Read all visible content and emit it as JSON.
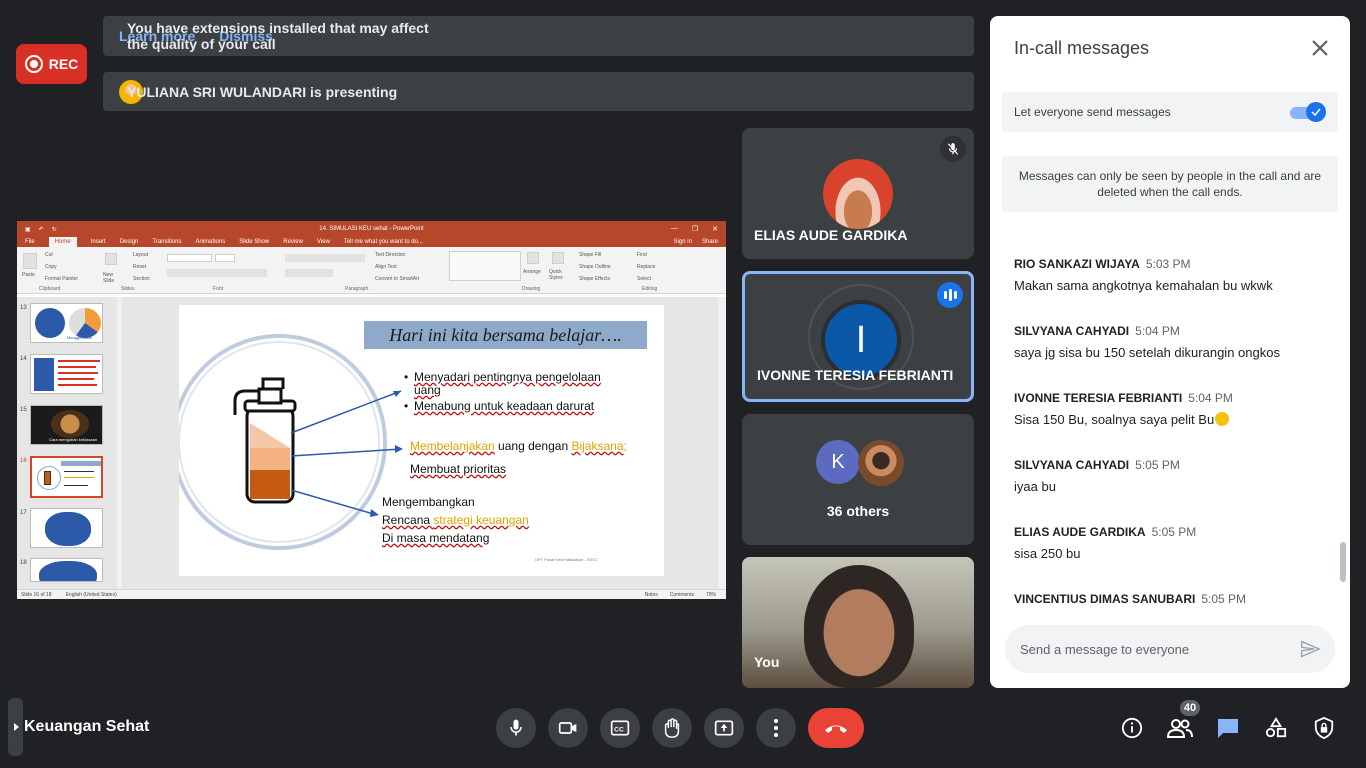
{
  "rec": {
    "label": "REC"
  },
  "banner_warning": {
    "message": "You have extensions installed that may affect the quality of your call",
    "learn_more": "Learn more",
    "dismiss": "Dismiss"
  },
  "banner_presenting": {
    "message": "YULIANA SRI WULANDARI is presenting"
  },
  "powerpoint": {
    "window_title": "14. SIMULASI KEU sehat - PowerPoint",
    "tabs": [
      "File",
      "Home",
      "Insert",
      "Design",
      "Transitions",
      "Animations",
      "Slide Show",
      "Review",
      "View",
      "Tell me what you want to do..."
    ],
    "active_tab": "Home",
    "sign_in": "Sign in",
    "share": "Share",
    "ribbon_groups": [
      "Clipboard",
      "Slides",
      "Font",
      "Paragraph",
      "Drawing",
      "Editing"
    ],
    "ribbon_items": {
      "paste": "Paste",
      "cut": "Cut",
      "copy": "Copy",
      "format_painter": "Format Painter",
      "new_slide": "New Slide",
      "layout": "Layout",
      "reset": "Reset",
      "section": "Section",
      "text_direction": "Text Direction",
      "align_text": "Align Text",
      "convert_smartart": "Convert to SmartArt",
      "arrange": "Arrange",
      "quick_styles": "Quick Styles",
      "shape_fill": "Shape Fill",
      "shape_outline": "Shape Outline",
      "shape_effects": "Shape Effects",
      "find": "Find",
      "replace": "Replace",
      "select": "Select"
    },
    "thumbnails": [
      {
        "num": "13",
        "caption": "Menggelolaan"
      },
      {
        "num": "14",
        "caption": ""
      },
      {
        "num": "15",
        "caption": "Cara mengubah kebiasaan"
      },
      {
        "num": "16",
        "caption": ""
      },
      {
        "num": "17",
        "caption": ""
      },
      {
        "num": "18",
        "caption": ""
      }
    ],
    "slide": {
      "title": "Hari ini kita bersama belajar….",
      "bullet1": "Menyadari pentingnya pengelolaan uang",
      "bullet2": "Menabung untuk keadaan darurat",
      "line3a": "Membelanjakan",
      "line3b": " uang dengan ",
      "line3c": "Bijaksana",
      "line3d": ";",
      "line4": "Membuat prioritas",
      "line5": "Mengembangkan",
      "line6a": "Rencana ",
      "line6b": "strategi keuangan",
      "line7": "Di masa mendatang",
      "footer": "UPT Pusat Kerin Makassar - SSCC"
    },
    "status": {
      "slide_of": "Slide 16 of 18",
      "language": "English (United States)",
      "notes": "Notes",
      "comments": "Comments",
      "zoom": "79%"
    }
  },
  "participants": [
    {
      "name": "ELIAS AUDE GARDIKA",
      "muted": true
    },
    {
      "name": "IVONNE TERESIA FEBRIANTI",
      "initial": "I",
      "speaking": true
    },
    {
      "others_label": "36 others",
      "initial": "K"
    },
    {
      "name": "You"
    }
  ],
  "panel": {
    "title": "In-call messages",
    "toggle_label": "Let everyone send messages",
    "toggle_on": true,
    "note": "Messages can only be seen by people in the call and are deleted when the call ends.",
    "messages": [
      {
        "sender": "RIO SANKAZI WIJAYA",
        "time": "5:03 PM",
        "text": "Makan sama angkotnya kemahalan bu wkwk"
      },
      {
        "sender": "SILVYANA CAHYADI",
        "time": "5:04 PM",
        "text": "saya jg sisa bu 150 setelah dikurangin ongkos"
      },
      {
        "sender": "IVONNE TERESIA FEBRIANTI",
        "time": "5:04 PM",
        "text": "Sisa 150 Bu, soalnya saya pelit Bu"
      },
      {
        "sender": "SILVYANA CAHYADI",
        "time": "5:05 PM",
        "text": "iyaa bu"
      },
      {
        "sender": "ELIAS AUDE GARDIKA",
        "time": "5:05 PM",
        "text": "sisa 250 bu"
      },
      {
        "sender": "VINCENTIUS DIMAS SANUBARI",
        "time": "5:05 PM",
        "text": ""
      }
    ],
    "input_placeholder": "Send a message to everyone"
  },
  "bottom_bar": {
    "meeting_name": "Keuangan Sehat",
    "participant_count": "40"
  },
  "colors": {
    "background": "#202124",
    "rec": "#d93025",
    "end_call": "#ea4335",
    "accent": "#1a73e8",
    "link": "#8ab4f8",
    "powerpoint": "#b7472a"
  }
}
